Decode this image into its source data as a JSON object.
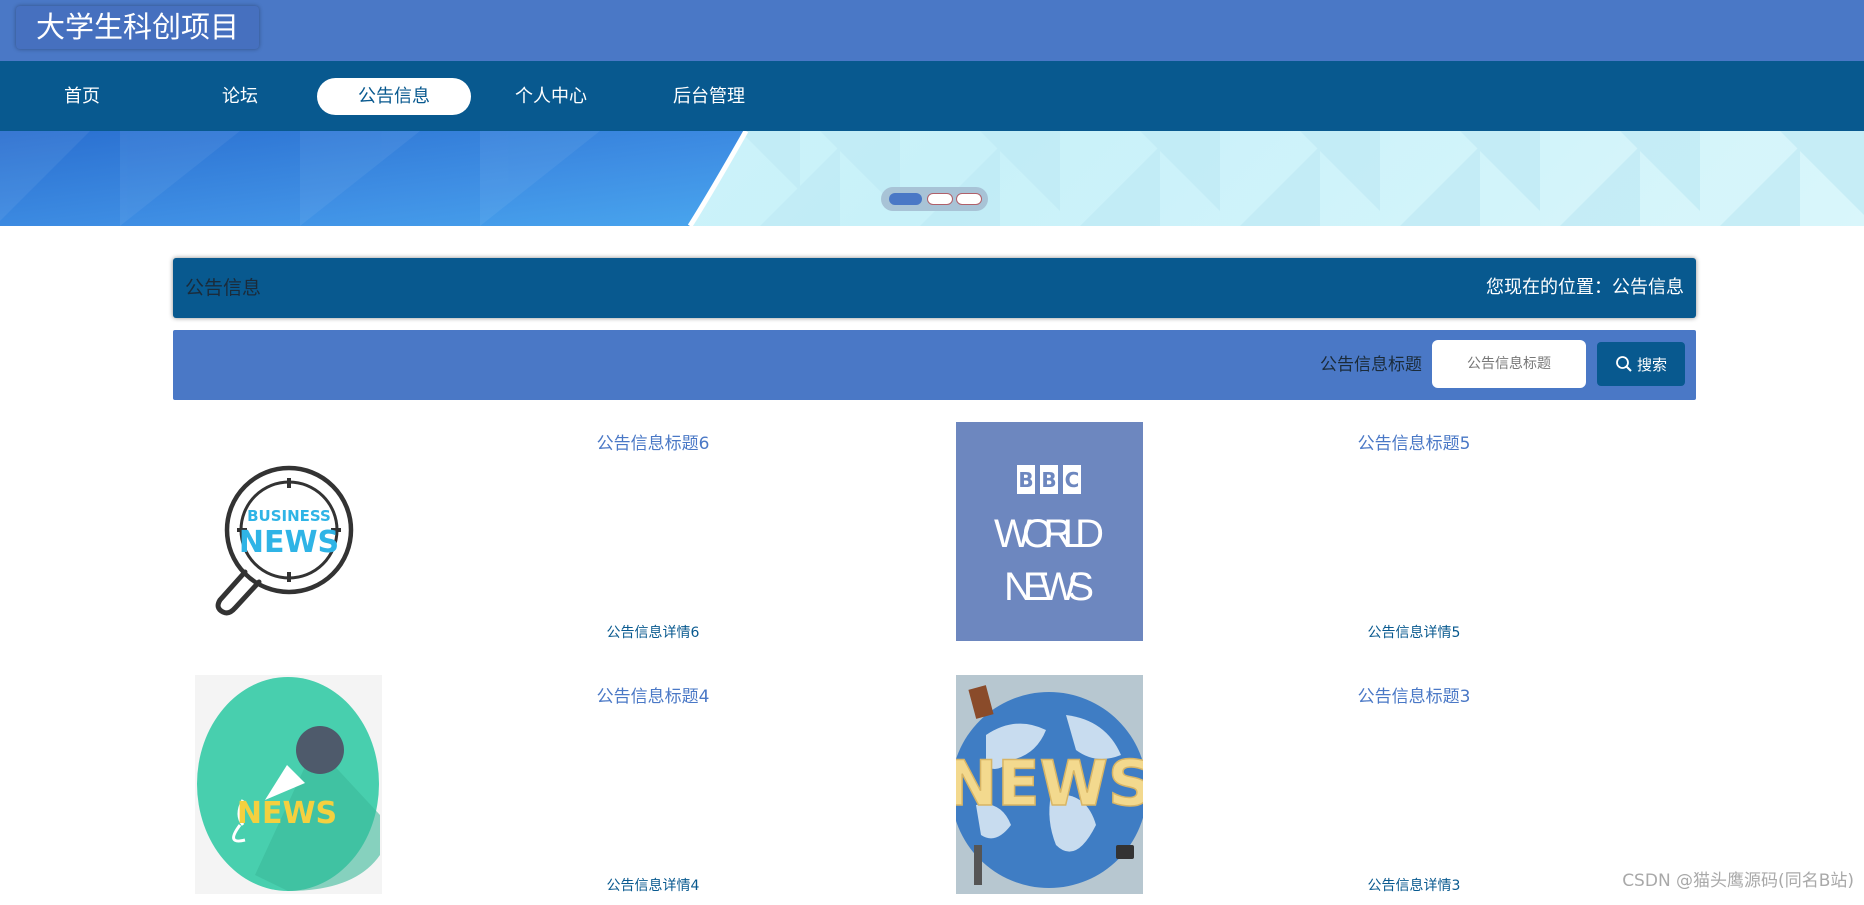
{
  "header": {
    "site_title": "大学生科创项目"
  },
  "nav": {
    "items": [
      {
        "label": "首页"
      },
      {
        "label": "论坛"
      },
      {
        "label": "公告信息"
      },
      {
        "label": "个人中心"
      },
      {
        "label": "后台管理"
      }
    ],
    "active_index": 2
  },
  "section": {
    "title": "公告信息",
    "breadcrumb": "您现在的位置：公告信息"
  },
  "search": {
    "label": "公告信息标题",
    "placeholder": "公告信息标题",
    "button_label": "搜索"
  },
  "cards": [
    {
      "title": "公告信息标题6",
      "detail": "公告信息详情6",
      "image_icon": "business-news-image"
    },
    {
      "title": "公告信息标题5",
      "detail": "公告信息详情5",
      "image_icon": "bbc-world-news-image"
    },
    {
      "title": "公告信息标题4",
      "detail": "公告信息详情4",
      "image_icon": "news-microphone-image"
    },
    {
      "title": "公告信息标题3",
      "detail": "公告信息详情3",
      "image_icon": "news-globe-image"
    }
  ],
  "image_text": {
    "business": "BUSINESS",
    "news": "NEWS",
    "bbc": [
      "B",
      "B",
      "C"
    ],
    "world": "WORLD",
    "news2": "NEWS"
  },
  "watermark": "CSDN @猫头鹰源码(同名B站)",
  "colors": {
    "topbar": "#4a78c6",
    "navbar": "#08598f",
    "accent": "#4a78c6",
    "section_bar": "#08598f"
  }
}
